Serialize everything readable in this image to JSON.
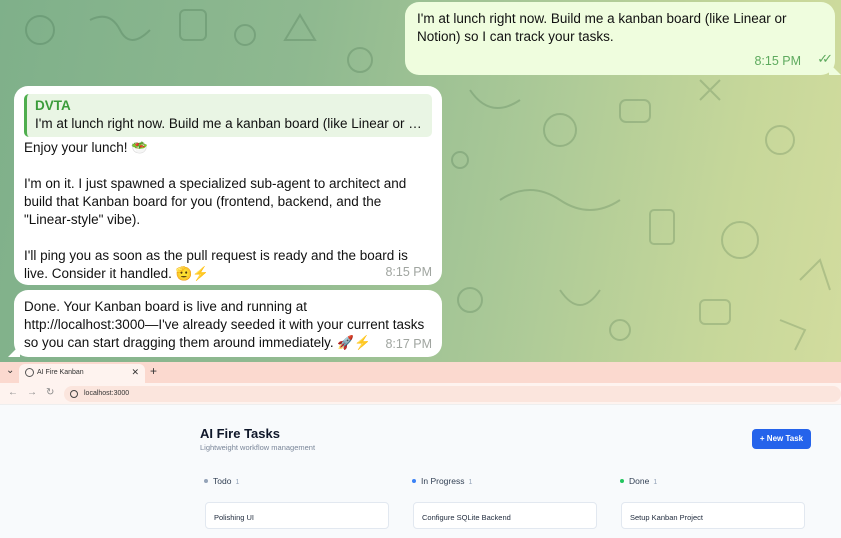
{
  "chat": {
    "messages": [
      {
        "direction": "outgoing",
        "text": "I'm at lunch right now. Build me a kanban board (like Linear or Notion) so I can track your tasks.",
        "time": "8:15 PM",
        "status": "read"
      },
      {
        "direction": "incoming",
        "reply_to": {
          "name": "DVTA",
          "text": "I'm at lunch right now. Build me a kanban board (like Linear or N..."
        },
        "paragraphs": [
          "Enjoy your lunch! 🥗",
          "I'm on it. I just spawned a specialized sub-agent to architect and build that Kanban board for you (frontend, backend, and the \"Linear-style\" vibe).",
          "I'll ping you as soon as the pull request is ready and the board is live. Consider it handled. 🫡⚡"
        ],
        "time": "8:15 PM"
      },
      {
        "direction": "incoming",
        "text": "Done. Your Kanban board is live and running at http://localhost:3000—I've already seeded it with your current tasks so you can start dragging them around immediately. 🚀⚡",
        "time": "8:17 PM"
      }
    ]
  },
  "browser": {
    "tab_title": "AI Fire Kanban",
    "address": "localhost:3000",
    "icons": [
      "chevron-down-icon",
      "globe-icon",
      "close-icon",
      "plus-icon",
      "back-icon",
      "forward-icon",
      "reload-icon",
      "info-icon"
    ]
  },
  "app": {
    "title": "AI Fire Tasks",
    "subtitle": "Lightweight workflow management",
    "new_task_label": "+ New Task",
    "columns": [
      {
        "name": "Todo",
        "count": "1",
        "dot_color": "#94a3b8",
        "cards": [
          "Polishing UI"
        ]
      },
      {
        "name": "In Progress",
        "count": "1",
        "dot_color": "#3b82f6",
        "cards": [
          "Configure SQLite Backend"
        ]
      },
      {
        "name": "Done",
        "count": "1",
        "dot_color": "#22c55e",
        "cards": [
          "Setup Kanban Project"
        ]
      }
    ]
  },
  "colors": {
    "outgoing_bubble": "#effdde",
    "incoming_bubble": "#ffffff",
    "accent_green": "#4fae4e",
    "primary_button": "#2563eb"
  }
}
